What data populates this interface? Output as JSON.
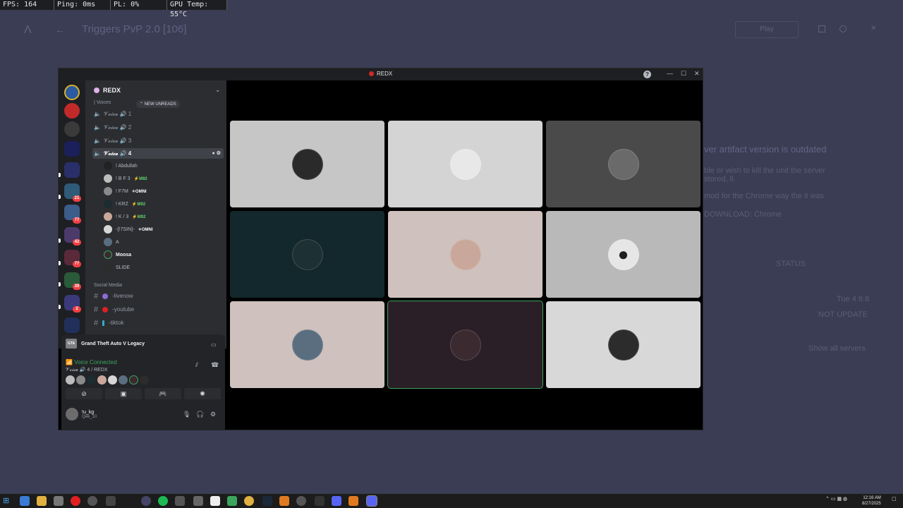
{
  "overlay": {
    "fps": "FPS: 164",
    "ping": "Ping: 0ms",
    "pl": "PL: 0%",
    "gpu": "GPU Temp: 55°C"
  },
  "background": {
    "title": "Triggers PvP 2.0 [106]",
    "button": "Play",
    "notice": "ver artifact version is outdated",
    "lines": [
      "ble or wish to kill the unit the server",
      "stored, ll.",
      "mod for the Chrome way the it was",
      "DOWNLOAD: Chrome"
    ],
    "panel": [
      "STATUS",
      "NOT UPDATE",
      "Tue 4 6:8",
      "Show all servers"
    ]
  },
  "window": {
    "title": "REDX",
    "help": "?"
  },
  "server": {
    "name": "REDX",
    "category_voices": "| Voices",
    "new_unreads": "NEW UNREADS",
    "voice_channels": [
      {
        "label": "𝓥𝓸𝓲𝓬𝓮 🔊 1"
      },
      {
        "label": "𝓥𝓸𝓲𝓬𝓮 🔊 2"
      },
      {
        "label": "𝓥𝓸𝓲𝓬𝓮 🔊 3"
      },
      {
        "label": "𝓥𝓸𝓲𝓬𝓮 🔊 4"
      }
    ],
    "members": [
      {
        "name": "! Abdullah",
        "tag": ""
      },
      {
        "name": "! B F 3",
        "tag": "⚡M92"
      },
      {
        "name": "! F7M",
        "tag": "✧OMNI"
      },
      {
        "name": "! KRZ",
        "tag": "⚡M92"
      },
      {
        "name": "! K / 3",
        "tag": "⚡M92"
      },
      {
        "name": "-{!7SIN}-",
        "tag": "✧OMNI"
      },
      {
        "name": "A",
        "tag": ""
      },
      {
        "name": "Moosa",
        "tag": ""
      },
      {
        "name": "SLIDE",
        "tag": ""
      }
    ],
    "category_social": "Social Media",
    "text_channels": [
      {
        "label": "-livenow",
        "color": "#8e6ad8"
      },
      {
        "label": "-youtube",
        "color": "#e02020"
      },
      {
        "label": "-tiktok",
        "color": "#2bb0c8"
      }
    ]
  },
  "rail_badges": [
    "21",
    "77",
    "42",
    "77",
    "39",
    "2"
  ],
  "activity": {
    "game": "Grand Theft Auto V Legacy",
    "gta_tag": "GTA"
  },
  "voice": {
    "status": "Voice Connected",
    "channel": "𝓥𝓸𝓲𝓬𝓮 🔊 4 / REDX"
  },
  "user": {
    "name": "!u_kg",
    "status": "Qee_10"
  },
  "tiles": [
    {
      "bg": "#c6c6c6",
      "face": "#2a2a2a"
    },
    {
      "bg": "#d4d4d4",
      "face": "#e8e8e8"
    },
    {
      "bg": "#4a4a4a",
      "face": "#6a6a6a"
    },
    {
      "bg": "#13282c",
      "face": "#1d3033"
    },
    {
      "bg": "#cfc1bd",
      "face": "#c9a79a"
    },
    {
      "bg": "#b9b9b9",
      "face": "#e6e6e6"
    },
    {
      "bg": "#cfc1bd",
      "face": "#5a6e80"
    },
    {
      "bg": "#2a1f27",
      "face": "#3b2a30"
    },
    {
      "bg": "#d8d8d8",
      "face": "#2c2c2c"
    }
  ],
  "clock": {
    "time": "12:16 AM",
    "date": "8/27/2025"
  }
}
